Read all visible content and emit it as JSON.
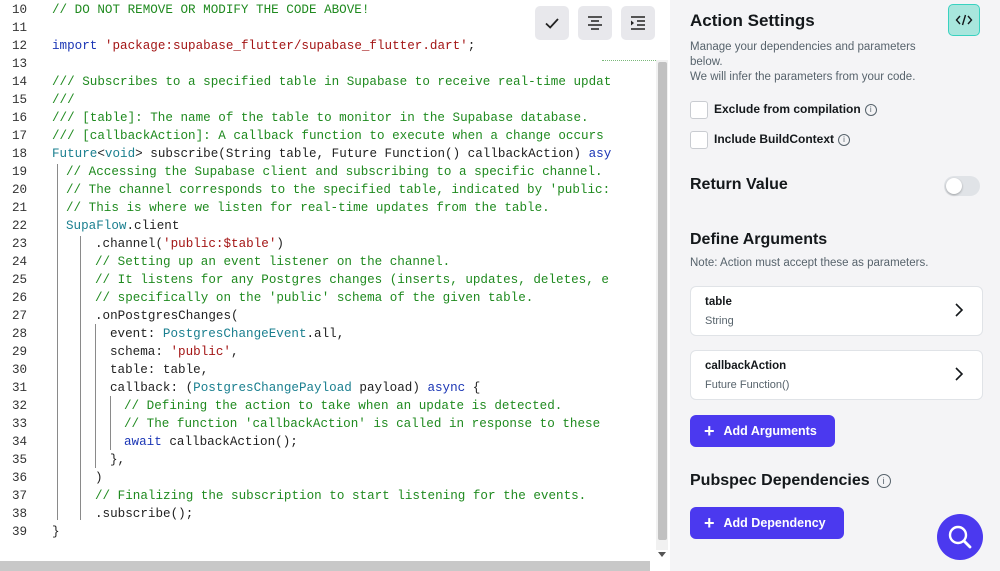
{
  "editor": {
    "line_numbers": [
      "10",
      "11",
      "12",
      "13",
      "14",
      "15",
      "16",
      "17",
      "18",
      "19",
      "20",
      "21",
      "22",
      "23",
      "24",
      "25",
      "26",
      "27",
      "28",
      "29",
      "30",
      "31",
      "32",
      "33",
      "34",
      "35",
      "36",
      "37",
      "38",
      "39"
    ],
    "toolbar": {
      "confirm_icon": "checkmark-icon",
      "format_icon": "align-center-icon",
      "indent_icon": "indent-icon"
    },
    "code": {
      "l10": "// DO NOT REMOVE OR MODIFY THE CODE ABOVE!",
      "l12_kw": "import",
      "l12_str": "'package:supabase_flutter/supabase_flutter.dart'",
      "l12_end": ";",
      "l14": "/// Subscribes to a specified table in Supabase to receive real-time updat",
      "l15": "///",
      "l16": "/// [table]: The name of the table to monitor in the Supabase database.",
      "l17": "/// [callbackAction]: A callback function to execute when a change occurs",
      "l18_a": "Future",
      "l18_b": "<",
      "l18_c": "void",
      "l18_d": "> subscribe(String table, Future Function() callbackAction) ",
      "l18_e": "asy",
      "l19": "// Accessing the Supabase client and subscribing to a specific channel.",
      "l20": "// The channel corresponds to the specified table, indicated by 'public:",
      "l21": "// This is where we listen for real-time updates from the table.",
      "l22_a": "SupaFlow",
      "l22_b": ".client",
      "l23_a": ".channel(",
      "l23_b": "'public:$table'",
      "l23_c": ")",
      "l24": "// Setting up an event listener on the channel.",
      "l25": "// It listens for any Postgres changes (inserts, updates, deletes, e",
      "l26": "// specifically on the 'public' schema of the given table.",
      "l27": ".onPostgresChanges(",
      "l28_a": "event: ",
      "l28_b": "PostgresChangeEvent",
      "l28_c": ".all,",
      "l29_a": "schema: ",
      "l29_b": "'public'",
      "l29_c": ",",
      "l30": "table: table,",
      "l31_a": "callback: (",
      "l31_b": "PostgresChangePayload",
      "l31_c": " payload) ",
      "l31_d": "async",
      "l31_e": " {",
      "l32": "// Defining the action to take when an update is detected.",
      "l33": "// The function 'callbackAction' is called in response to these",
      "l34_a": "await",
      "l34_b": " callbackAction();",
      "l35": "},",
      "l36": ")",
      "l37": "// Finalizing the subscription to start listening for the events.",
      "l38": ".subscribe();",
      "l39": "}"
    }
  },
  "panel": {
    "title": "Action Settings",
    "code_icon": "code-brackets-icon",
    "desc1": "Manage your dependencies and parameters below.",
    "desc2": "We will infer the parameters from your code.",
    "exclude_label": "Exclude from compilation",
    "include_label": "Include BuildContext",
    "return_title": "Return Value",
    "return_enabled": false,
    "args_title": "Define Arguments",
    "args_note": "Note: Action must accept these as parameters.",
    "arguments": [
      {
        "name": "table",
        "type": "String"
      },
      {
        "name": "callbackAction",
        "type": "Future Function()"
      }
    ],
    "add_args_label": "Add Arguments",
    "deps_title": "Pubspec Dependencies",
    "add_dep_label": "Add Dependency"
  },
  "colors": {
    "primary": "#4b39ef",
    "accent": "#39d2c0",
    "comment": "#1f8a1f",
    "keyword": "#1b36b5",
    "string": "#a31515"
  },
  "fab_icon": "search-icon"
}
